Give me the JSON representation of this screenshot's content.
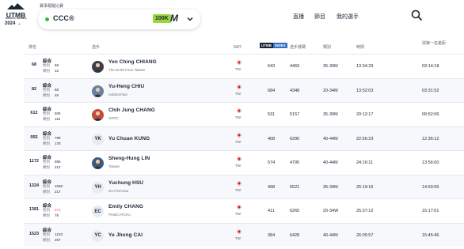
{
  "header": {
    "logo_text": "UTMB",
    "logo_sub": "WORLD SERIES",
    "year": "2024",
    "race_caption": "賽事跟蹤比賽",
    "race_name": "CCC®",
    "race_badge": "100K",
    "race_badge_letter": "M",
    "nav": [
      "直播",
      "節目",
      "我的選手"
    ],
    "colors": {
      "badge": "#98d83a",
      "dot": "#2ec04f",
      "index_blue": "#2f71c3"
    }
  },
  "table": {
    "columns": {
      "rank": "排名",
      "runner": "选手",
      "nat": "NAT.",
      "index_a": "UTMB",
      "index_b": "INDEX",
      "bib": "选手號碼",
      "category": "類別",
      "time": "時間",
      "gap": "與第一名差距"
    },
    "cat_label": "綜合",
    "sex_label": "性別",
    "cat_small_label": "類別",
    "rows": [
      {
        "rank": "68",
        "sex": "58",
        "cat": "12",
        "name": "Yen Ching CHIANG",
        "club": "The North Face Taiwan",
        "avatar": "photo",
        "initials": "",
        "nat": "TW",
        "index": "643",
        "bib": "4469",
        "category": "35-39M",
        "time": "13:34:29",
        "gap": "03:14:18",
        "sex_red": false
      },
      {
        "rank": "82",
        "sex": "68",
        "cat": "45",
        "name": "Yu-Heng CHIU",
        "club": "outdoorman",
        "avatar": "photo",
        "initials": "",
        "nat": "TW",
        "index": "684",
        "bib": "4348",
        "category": "20-34M",
        "time": "13:52:03",
        "gap": "03:31:52",
        "sex_red": false
      },
      {
        "rank": "612",
        "sex": "505",
        "cat": "116",
        "name": "Chih Jung CHANG",
        "club": "GFRC",
        "avatar": "photo",
        "initials": "",
        "nat": "TW",
        "index": "531",
        "bib": "5157",
        "category": "35-39M",
        "time": "20:12:17",
        "gap": "09:52:06",
        "sex_red": false
      },
      {
        "rank": "955",
        "sex": "789",
        "cat": "178",
        "name": "Yu Chuan KUNG",
        "club": "",
        "avatar": "initials",
        "initials": "YK",
        "nat": "TW",
        "index": "408",
        "bib": "6290",
        "category": "40-44M",
        "time": "22:56:23",
        "gap": "12:36:12",
        "sex_red": false
      },
      {
        "rank": "1172",
        "sex": "955",
        "cat": "212",
        "name": "Sheng-Hung LIN",
        "club": "Taiwan",
        "avatar": "photo",
        "initials": "",
        "nat": "TW",
        "index": "574",
        "bib": "4795",
        "category": "40-44M",
        "time": "24:16:11",
        "gap": "13:56:00",
        "sex_red": false
      },
      {
        "rank": "1324",
        "sex": "1068",
        "cat": "217",
        "name": "Yuchung HSU",
        "club": "Go Formosa",
        "avatar": "initials",
        "initials": "YH",
        "nat": "TW",
        "index": "498",
        "bib": "5521",
        "category": "35-39M",
        "time": "25:19:16",
        "gap": "14:59:05",
        "sex_red": false
      },
      {
        "rank": "1381",
        "sex": "271",
        "cat": "78",
        "name": "Emily CHANG",
        "club": "PeakCATCHu",
        "avatar": "initials",
        "initials": "EC",
        "nat": "TW",
        "index": "411",
        "bib": "6265",
        "category": "20-34W",
        "time": "25:37:12",
        "gap": "15:17:01",
        "sex_red": true
      },
      {
        "rank": "1523",
        "sex": "1210",
        "cat": "257",
        "name": "Ye Jhong CAI",
        "club": "",
        "avatar": "initials",
        "initials": "YC",
        "nat": "TW",
        "index": "384",
        "bib": "6428",
        "category": "40-44M",
        "time": "26:05:57",
        "gap": "15:45:46",
        "sex_red": false
      }
    ]
  }
}
